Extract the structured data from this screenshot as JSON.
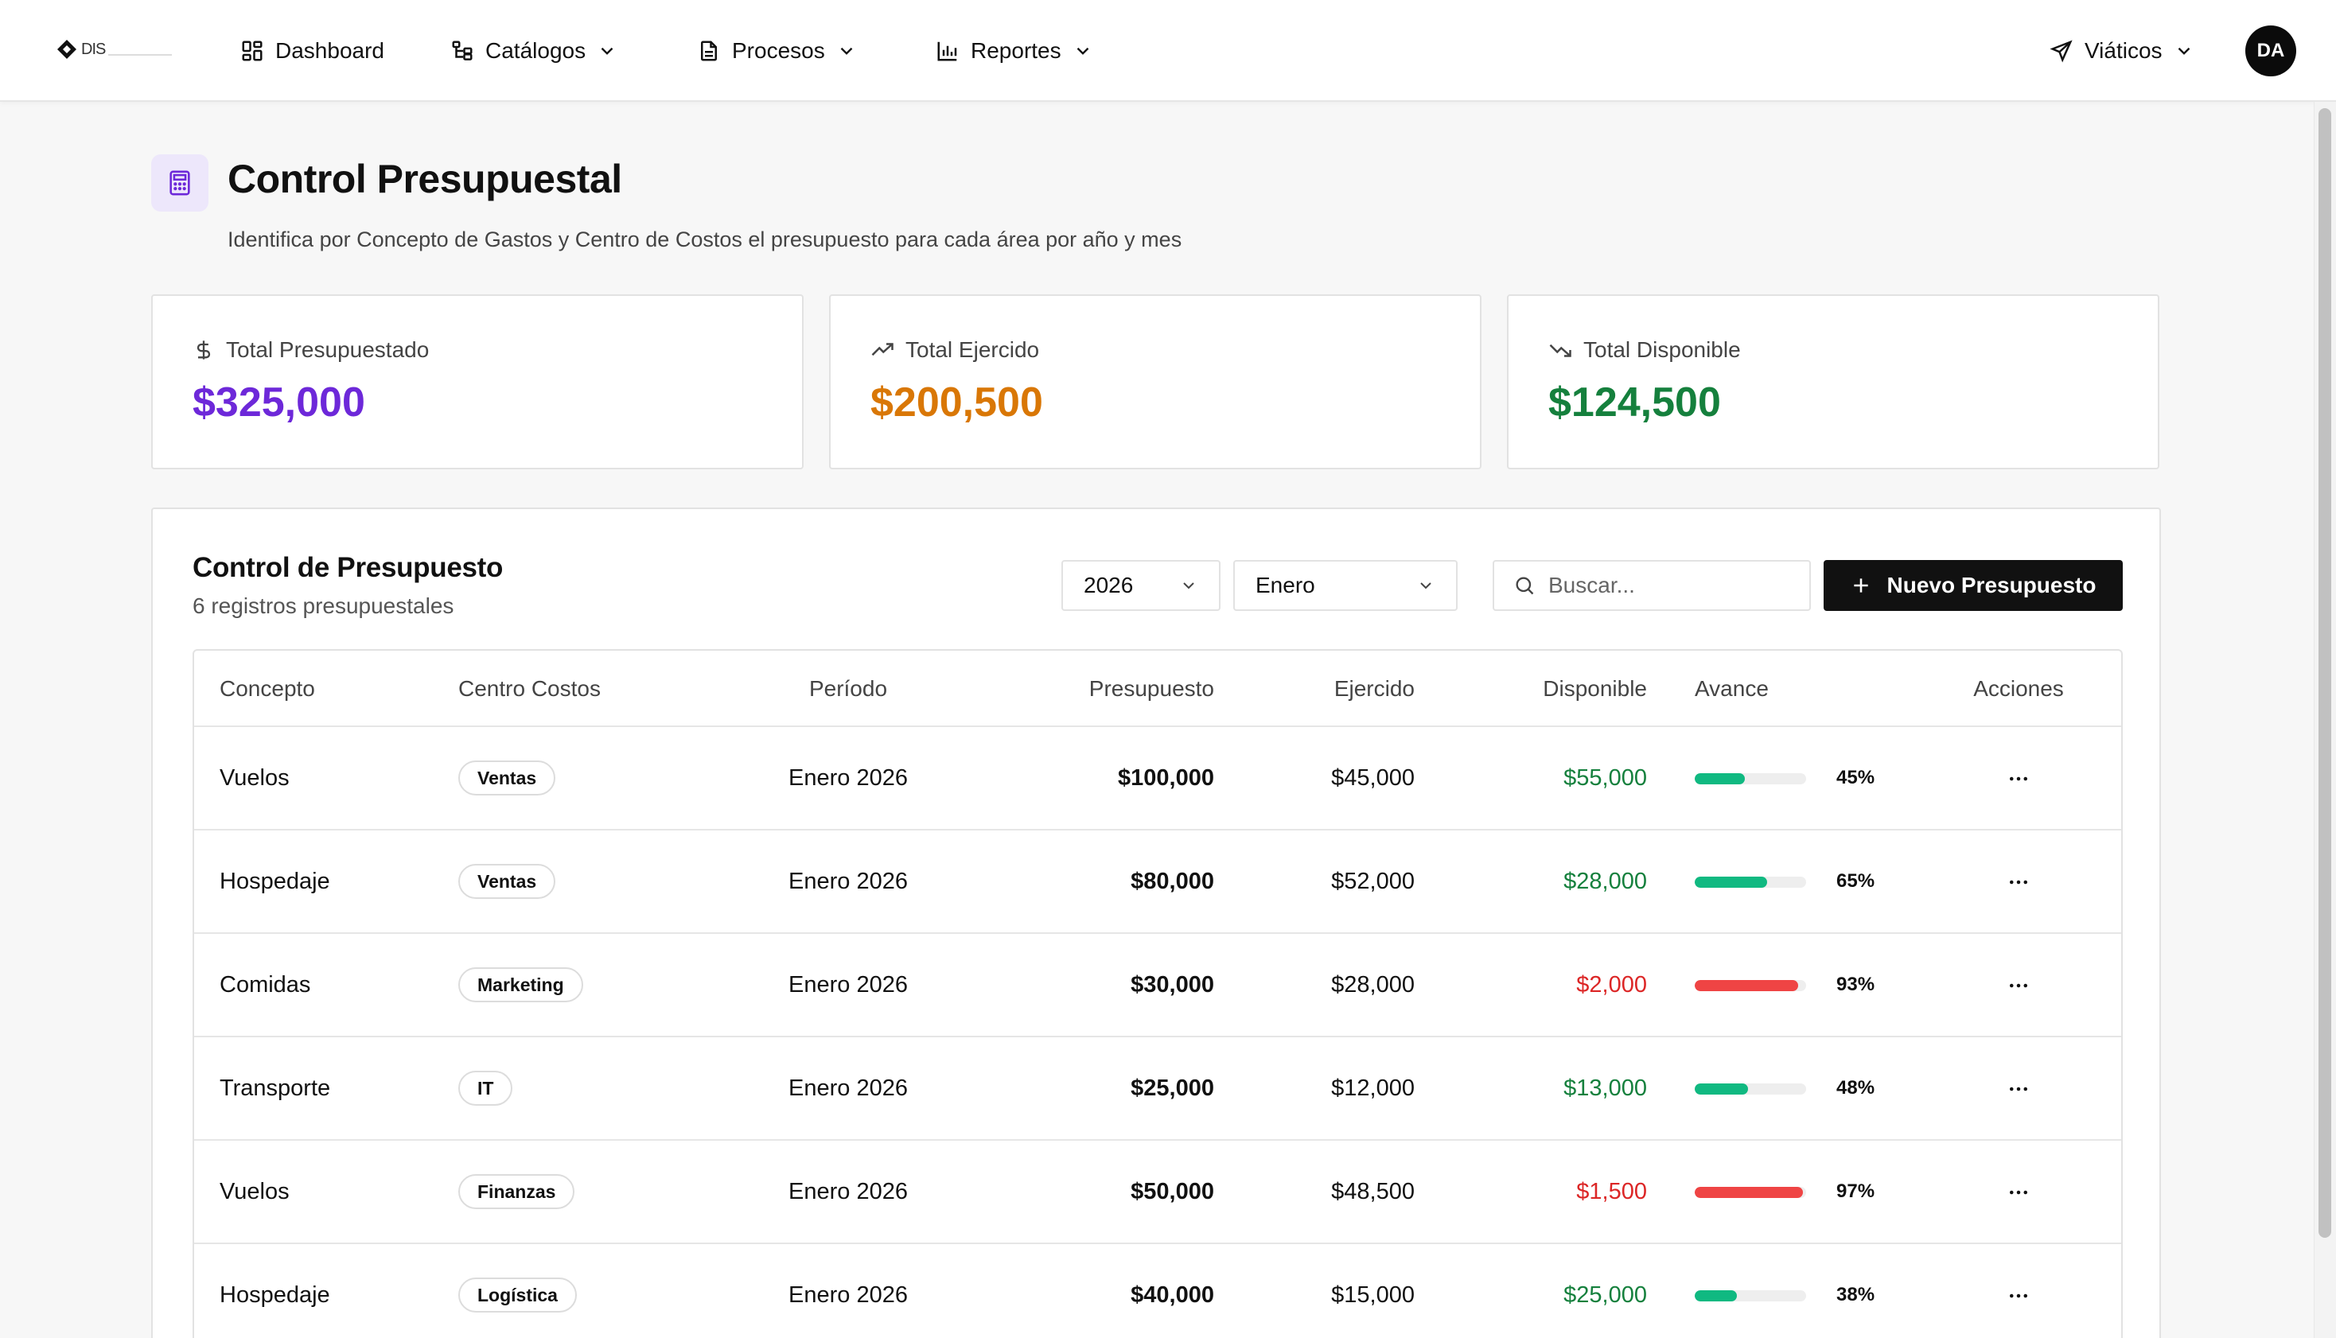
{
  "brand": {
    "logo_text": "DIS"
  },
  "nav": {
    "items": [
      {
        "label": "Dashboard",
        "icon": "dashboard-grid-icon"
      },
      {
        "label": "Catálogos",
        "icon": "catalog-tree-icon"
      },
      {
        "label": "Procesos",
        "icon": "document-icon"
      },
      {
        "label": "Reportes",
        "icon": "bar-chart-icon"
      }
    ],
    "module": {
      "label": "Viáticos",
      "icon": "plane-icon"
    },
    "avatar": "DA"
  },
  "header": {
    "title": "Control Presupuestal",
    "subtitle": "Identifica por Concepto de Gastos y Centro de Costos el presupuesto para cada área por año y mes"
  },
  "summary": [
    {
      "label": "Total Presupuestado",
      "value": "$325,000",
      "color": "#6d28d9",
      "icon": "dollar-icon"
    },
    {
      "label": "Total Ejercido",
      "value": "$200,500",
      "color": "#d97706",
      "icon": "trending-up-icon"
    },
    {
      "label": "Total Disponible",
      "value": "$124,500",
      "color": "#15803d",
      "icon": "trending-down-icon"
    }
  ],
  "panel": {
    "title": "Control de Presupuesto",
    "subtitle": "6 registros presupuestales",
    "year": "2026",
    "month": "Enero",
    "search_placeholder": "Buscar...",
    "new_button": "Nuevo Presupuesto"
  },
  "table": {
    "headers": [
      "Concepto",
      "Centro Costos",
      "Período",
      "Presupuesto",
      "Ejercido",
      "Disponible",
      "Avance",
      "Acciones"
    ],
    "rows": [
      {
        "concepto": "Vuelos",
        "centro": "Ventas",
        "periodo": "Enero 2026",
        "presupuesto": "$100,000",
        "ejercido": "$45,000",
        "disponible": "$55,000",
        "avance": "45%",
        "progress": 0.45,
        "status": "ok"
      },
      {
        "concepto": "Hospedaje",
        "centro": "Ventas",
        "periodo": "Enero 2026",
        "presupuesto": "$80,000",
        "ejercido": "$52,000",
        "disponible": "$28,000",
        "avance": "65%",
        "progress": 0.65,
        "status": "ok"
      },
      {
        "concepto": "Comidas",
        "centro": "Marketing",
        "periodo": "Enero 2026",
        "presupuesto": "$30,000",
        "ejercido": "$28,000",
        "disponible": "$2,000",
        "avance": "93%",
        "progress": 0.93,
        "status": "alert"
      },
      {
        "concepto": "Transporte",
        "centro": "IT",
        "periodo": "Enero 2026",
        "presupuesto": "$25,000",
        "ejercido": "$12,000",
        "disponible": "$13,000",
        "avance": "48%",
        "progress": 0.48,
        "status": "ok"
      },
      {
        "concepto": "Vuelos",
        "centro": "Finanzas",
        "periodo": "Enero 2026",
        "presupuesto": "$50,000",
        "ejercido": "$48,500",
        "disponible": "$1,500",
        "avance": "97%",
        "progress": 0.97,
        "status": "alert"
      },
      {
        "concepto": "Hospedaje",
        "centro": "Logística",
        "periodo": "Enero 2026",
        "presupuesto": "$40,000",
        "ejercido": "$15,000",
        "disponible": "$25,000",
        "avance": "38%",
        "progress": 0.38,
        "status": "ok"
      }
    ]
  },
  "colors": {
    "ok": "#15803d",
    "alert": "#dc2626",
    "bar_ok": "#10b981",
    "bar_alert": "#ef4444"
  }
}
